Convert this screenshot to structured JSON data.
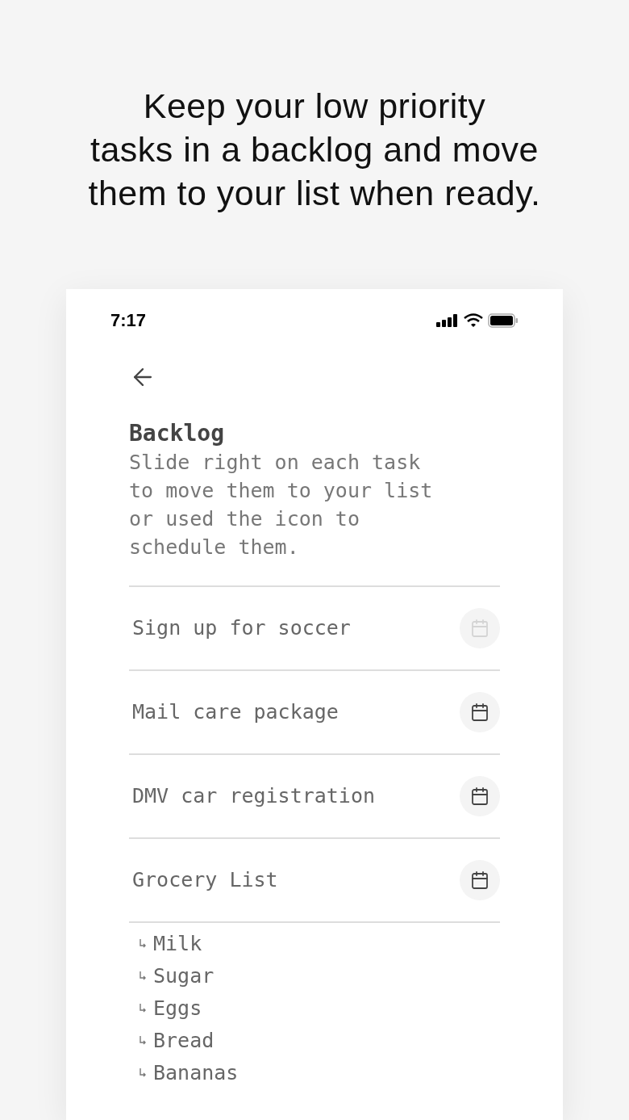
{
  "headline_lines": [
    "Keep your low priority",
    "tasks in a backlog and move",
    "them to your list when ready."
  ],
  "status_bar": {
    "time": "7:17"
  },
  "screen": {
    "title": "Backlog",
    "description": "Slide right on each task to move them to your list or used the icon to schedule them."
  },
  "tasks": [
    {
      "label": "Sign up for soccer",
      "disabled": true
    },
    {
      "label": "Mail care package",
      "disabled": false
    },
    {
      "label": "DMV car registration",
      "disabled": false
    },
    {
      "label": "Grocery List",
      "disabled": false,
      "children": [
        {
          "label": "Milk"
        },
        {
          "label": "Sugar"
        },
        {
          "label": "Eggs"
        },
        {
          "label": "Bread"
        },
        {
          "label": "Bananas"
        }
      ]
    }
  ]
}
